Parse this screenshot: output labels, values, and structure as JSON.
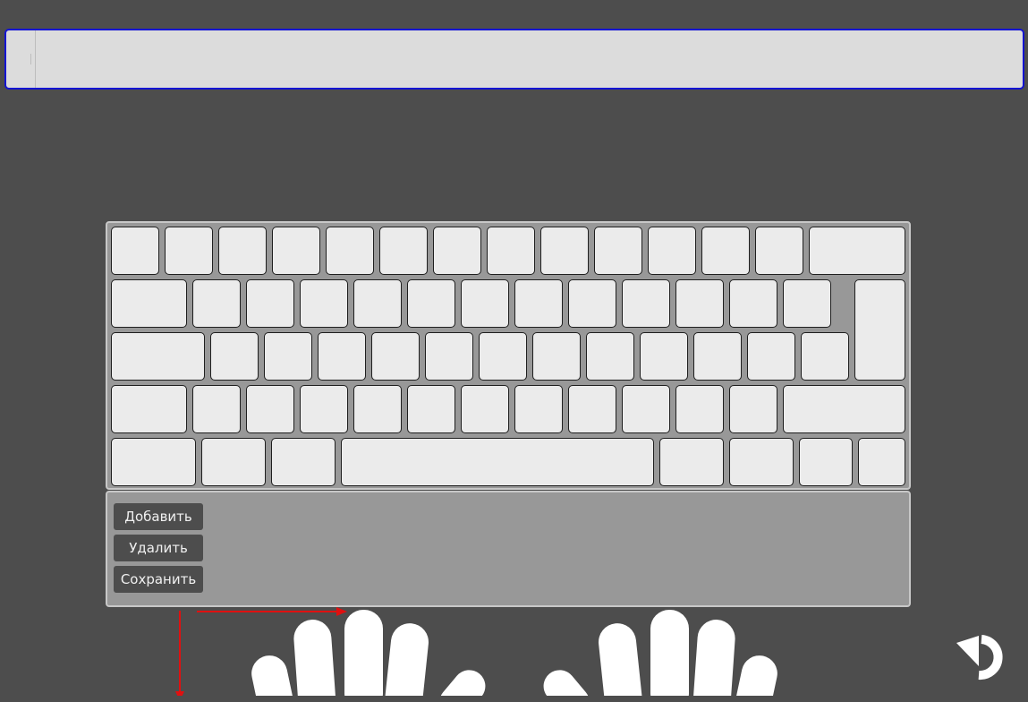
{
  "text_field": {
    "value": "",
    "placeholder": ""
  },
  "buttons": {
    "add_label": "Добавить",
    "delete_label": "Удалить",
    "save_label": "Сохранить"
  },
  "colors": {
    "background": "#4d4d4d",
    "input_border": "#1414d2",
    "key_fill": "#ebebeb",
    "keyboard_bg": "#989898",
    "guide_arrows": "#e01010"
  },
  "keyboard": {
    "rows": [
      {
        "keys": [
          "",
          "",
          "",
          "",
          "",
          "",
          "",
          "",
          "",
          "",
          "",
          "",
          "",
          ""
        ]
      },
      {
        "keys": [
          "",
          "",
          "",
          "",
          "",
          "",
          "",
          "",
          "",
          "",
          "",
          "",
          "",
          ""
        ]
      },
      {
        "keys": [
          "",
          "",
          "",
          "",
          "",
          "",
          "",
          "",
          "",
          "",
          "",
          "",
          ""
        ]
      },
      {
        "keys": [
          "",
          "",
          "",
          "",
          "",
          "",
          "",
          "",
          "",
          "",
          "",
          "",
          ""
        ]
      },
      {
        "keys": [
          "",
          "",
          "",
          "",
          "",
          "",
          "",
          ""
        ]
      }
    ],
    "key_labels_visible": false
  },
  "icons": {
    "undo": "undo-icon",
    "arrow_right": "arrow-right-icon",
    "arrow_down": "arrow-down-icon",
    "hands": "hands-illustration"
  }
}
